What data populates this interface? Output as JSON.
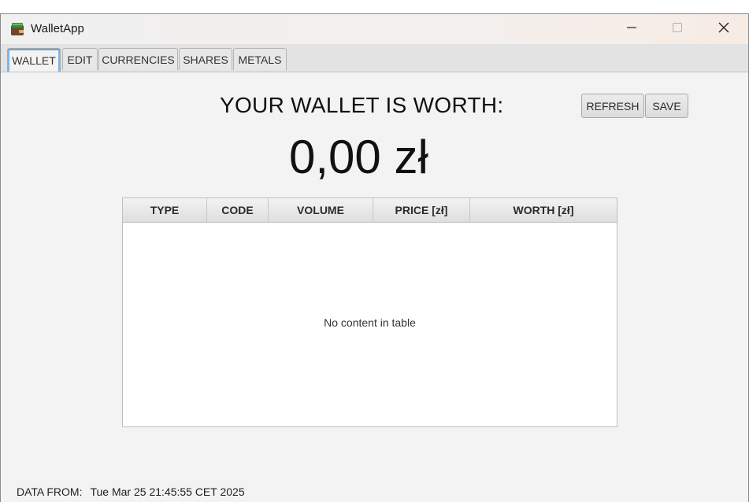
{
  "window": {
    "title": "WalletApp",
    "controls": {
      "minimize": "minimize-icon",
      "maximize": "maximize-icon",
      "close": "close-icon"
    }
  },
  "tabs": [
    {
      "label": "WALLET",
      "active": true
    },
    {
      "label": "EDIT",
      "active": false
    },
    {
      "label": "CURRENCIES",
      "active": false
    },
    {
      "label": "SHARES",
      "active": false
    },
    {
      "label": "METALS",
      "active": false
    }
  ],
  "main": {
    "heading": "YOUR WALLET IS WORTH:",
    "amount": "0,00 zł",
    "refresh_label": "REFRESH",
    "save_label": "SAVE"
  },
  "table": {
    "columns": [
      "TYPE",
      "CODE",
      "VOLUME",
      "PRICE [zł]",
      "WORTH [zł]"
    ],
    "rows": [],
    "empty_text": "No content in table"
  },
  "footer": {
    "label": "DATA FROM:",
    "timestamp": "Tue Mar 25 21:45:55 CET 2025"
  },
  "colors": {
    "active_tab_accent": "#5ea7e6",
    "window_bg": "#f3f3f3"
  }
}
